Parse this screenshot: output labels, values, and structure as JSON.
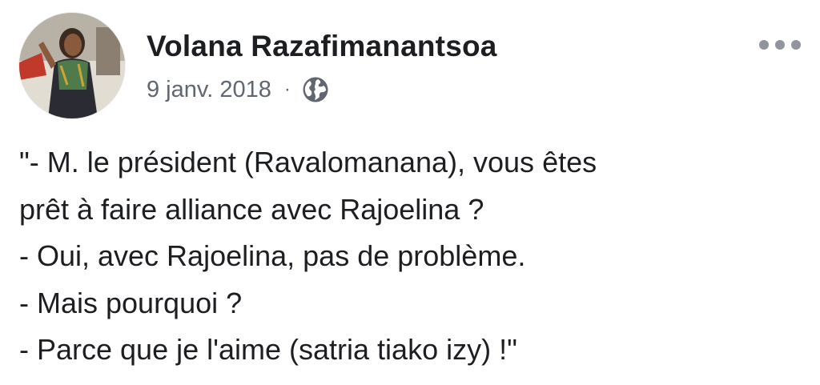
{
  "post": {
    "author": "Volana Razafimanantsoa",
    "date": "9 janv. 2018",
    "separator": "·",
    "privacy_icon": "globe-icon",
    "more_icon": "more-options-icon",
    "lines": [
      "\"- M. le président (Ravalomanana), vous êtes",
      "prêt à faire alliance avec Rajoelina ?",
      "- Oui, avec Rajoelina, pas de problème.",
      "- Mais pourquoi ?",
      "- Parce que je l'aime (satria tiako izy) !\""
    ]
  },
  "colors": {
    "text": "#1c1e21",
    "meta": "#606770",
    "icon": "#90949c"
  }
}
